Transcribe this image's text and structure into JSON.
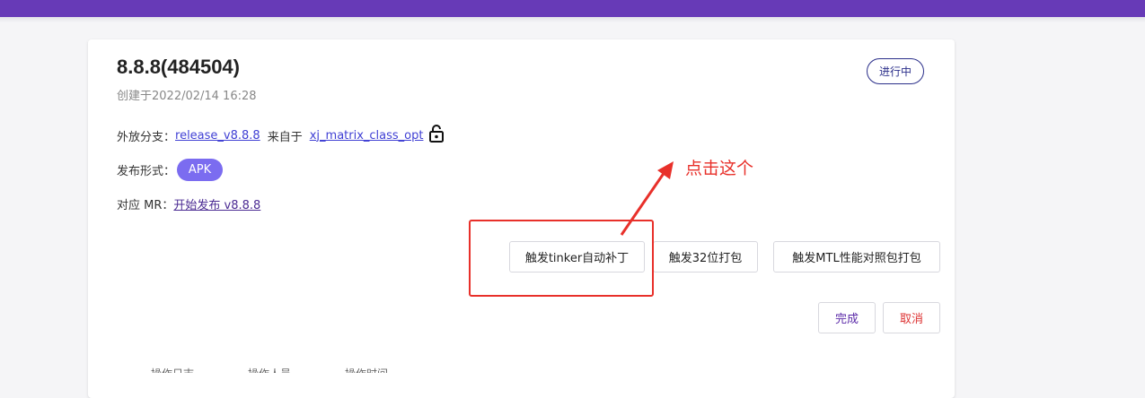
{
  "header": {
    "bar_color": "#673ab7"
  },
  "release": {
    "title": "8.8.8(484504)",
    "created": "创建于2022/02/14 16:28",
    "status": "进行中",
    "branch_label": "外放分支：",
    "branch_name": "release_v8.8.8",
    "from_label": "来自于",
    "source_branch": "xj_matrix_class_opt",
    "format_label": "发布形式：",
    "format_value": "APK",
    "mr_label": "对应 MR：",
    "mr_link": "开始发布 v8.8.8"
  },
  "actions": {
    "tinker": "触发tinker自动补丁",
    "build32": "触发32位打包",
    "mtl": "触发MTL性能对照包打包",
    "done": "完成",
    "cancel": "取消"
  },
  "annotation": {
    "text": "点击这个",
    "color": "#e8302a"
  },
  "cut_off_row": [
    "操作日志",
    "操作人员",
    "操作时间"
  ],
  "colors": {
    "accent": "#673ab7",
    "link": "#3f3fd4",
    "badge": "#7b6cf0",
    "danger": "#d33"
  }
}
